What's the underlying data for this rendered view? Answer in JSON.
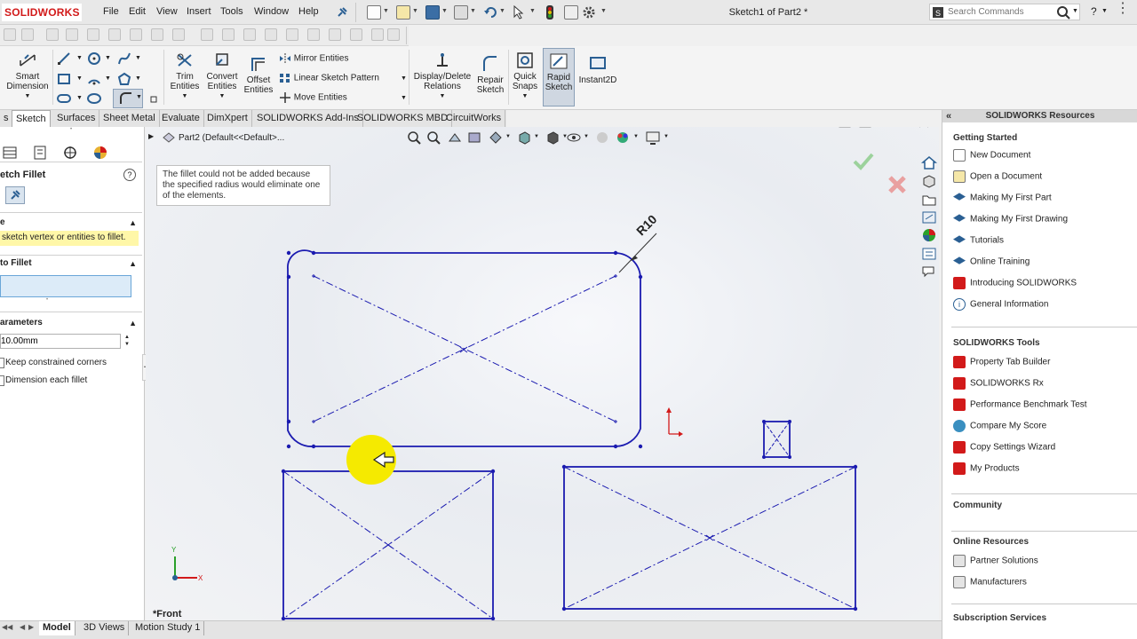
{
  "app": {
    "logo": "SOLIDWORKS",
    "menu": [
      "File",
      "Edit",
      "View",
      "Insert",
      "Tools",
      "Window",
      "Help"
    ],
    "document_title": "Sketch1 of Part2 *",
    "search_placeholder": "Search Commands",
    "help_label": "?"
  },
  "ribbon": {
    "smart_dimension": "Smart Dimension",
    "trim_entities": "Trim Entities",
    "convert_entities": "Convert Entities",
    "offset_entities": "Offset Entities",
    "mirror_entities": "Mirror Entities",
    "linear_sketch_pattern": "Linear Sketch Pattern",
    "move_entities": "Move Entities",
    "display_delete_relations": "Display/Delete Relations",
    "repair_sketch": "Repair Sketch",
    "quick_snaps": "Quick Snaps",
    "rapid_sketch": "Rapid Sketch",
    "instant2d": "Instant2D"
  },
  "tabs": [
    "s",
    "Sketch",
    "Surfaces",
    "Sheet Metal",
    "Evaluate",
    "DimXpert",
    "SOLIDWORKS Add-Ins",
    "SOLIDWORKS MBD",
    "CircuitWorks"
  ],
  "property_manager": {
    "title": "etch Fillet",
    "help": "?",
    "message_title": "e",
    "message": "sketch vertex or entities to fillet.",
    "entities_title": "to Fillet",
    "parameters_title": "arameters",
    "radius_value": "10.00mm",
    "keep_constrained": "Keep constrained corners",
    "dimension_each": "Dimension each fillet"
  },
  "viewport": {
    "tree_label": "Part2  (Default<<Default>...",
    "tooltip": "The fillet could not be added because the specified radius would eliminate one of the elements.",
    "dimension_label": "R10",
    "view_label": "*Front",
    "axis_x": "X",
    "axis_y": "Y"
  },
  "resources": {
    "title": "SOLIDWORKS Resources",
    "getting_started": "Getting Started",
    "getting_started_items": [
      "New Document",
      "Open a Document",
      "Making My First Part",
      "Making My First Drawing",
      "Tutorials",
      "Online Training",
      "Introducing SOLIDWORKS",
      "General Information"
    ],
    "tools_title": "SOLIDWORKS Tools",
    "tools_items": [
      "Property Tab Builder",
      "SOLIDWORKS Rx",
      "Performance Benchmark Test",
      "Compare My Score",
      "Copy Settings Wizard",
      "My Products"
    ],
    "community": "Community",
    "online_title": "Online Resources",
    "online_items": [
      "Partner Solutions",
      "Manufacturers"
    ],
    "subscription": "Subscription Services"
  },
  "bottom_tabs": [
    "Model",
    "3D Views",
    "Motion Study 1"
  ],
  "colors": {
    "sketch_blue": "#1b1bb0",
    "brand_red": "#d21a1a",
    "ribbon_blue": "#2a5f93",
    "highlight_yellow": "#f5ea00",
    "message_bg": "#fff7a8"
  }
}
